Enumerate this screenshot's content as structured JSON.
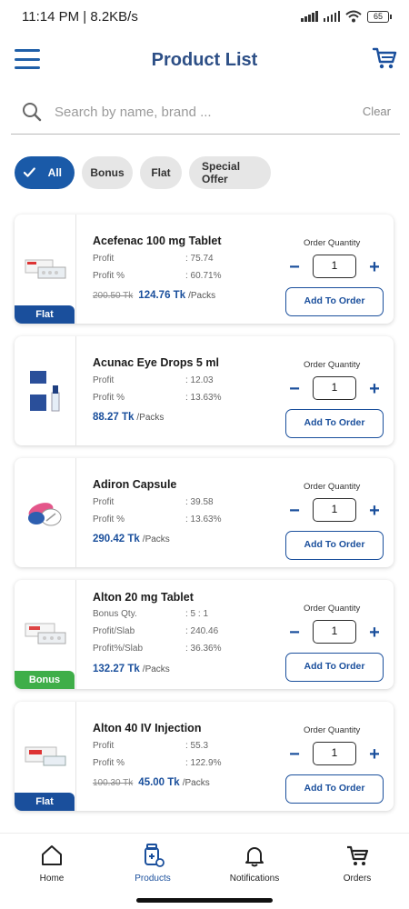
{
  "status": {
    "time_speed": "11:14 PM | 8.2KB/s",
    "battery": "65"
  },
  "header": {
    "title": "Product List"
  },
  "search": {
    "placeholder": "Search by name, brand ...",
    "clear_label": "Clear"
  },
  "filters": [
    {
      "label": "All",
      "active": true
    },
    {
      "label": "Bonus",
      "active": false
    },
    {
      "label": "Flat",
      "active": false
    },
    {
      "label": "Special Offer",
      "active": false
    }
  ],
  "order_quantity_label": "Order Quantity",
  "add_button_label": "Add To Order",
  "products": [
    {
      "name": "Acefenac 100 mg Tablet",
      "rows": [
        {
          "label": "Profit",
          "value": ": 75.74"
        },
        {
          "label": "Profit %",
          "value": ": 60.71%"
        }
      ],
      "old_price": "200.50 Tk",
      "price": "124.76 Tk",
      "unit": "/Packs",
      "quantity": "1",
      "tag": "Flat"
    },
    {
      "name": "Acunac Eye Drops 5 ml",
      "rows": [
        {
          "label": "Profit",
          "value": ": 12.03"
        },
        {
          "label": "Profit %",
          "value": ": 13.63%"
        }
      ],
      "old_price": "",
      "price": "88.27 Tk",
      "unit": "/Packs",
      "quantity": "1",
      "tag": ""
    },
    {
      "name": "Adiron Capsule",
      "rows": [
        {
          "label": "Profit",
          "value": ": 39.58"
        },
        {
          "label": "Profit %",
          "value": ": 13.63%"
        }
      ],
      "old_price": "",
      "price": "290.42 Tk",
      "unit": "/Packs",
      "quantity": "1",
      "tag": ""
    },
    {
      "name": "Alton 20 mg Tablet",
      "rows": [
        {
          "label": "Bonus Qty.",
          "value": ": 5 : 1"
        },
        {
          "label": "Profit/Slab",
          "value": ": 240.46"
        },
        {
          "label": "Profit%/Slab",
          "value": ": 36.36%"
        }
      ],
      "old_price": "",
      "price": "132.27 Tk",
      "unit": "/Packs",
      "quantity": "1",
      "tag": "Bonus"
    },
    {
      "name": "Alton 40 IV Injection",
      "rows": [
        {
          "label": "Profit",
          "value": ": 55.3"
        },
        {
          "label": "Profit %",
          "value": ": 122.9%"
        }
      ],
      "old_price": "100.30 Tk",
      "price": "45.00 Tk",
      "unit": "/Packs",
      "quantity": "1",
      "tag": "Flat"
    }
  ],
  "nav": [
    {
      "label": "Home",
      "icon": "home-icon",
      "active": false
    },
    {
      "label": "Products",
      "icon": "products-icon",
      "active": true
    },
    {
      "label": "Notifications",
      "icon": "bell-icon",
      "active": false
    },
    {
      "label": "Orders",
      "icon": "cart-icon",
      "active": false
    }
  ],
  "colors": {
    "primary": "#1a4f9c",
    "flat_tag": "#1a4f9c",
    "bonus_tag": "#3fae49"
  }
}
